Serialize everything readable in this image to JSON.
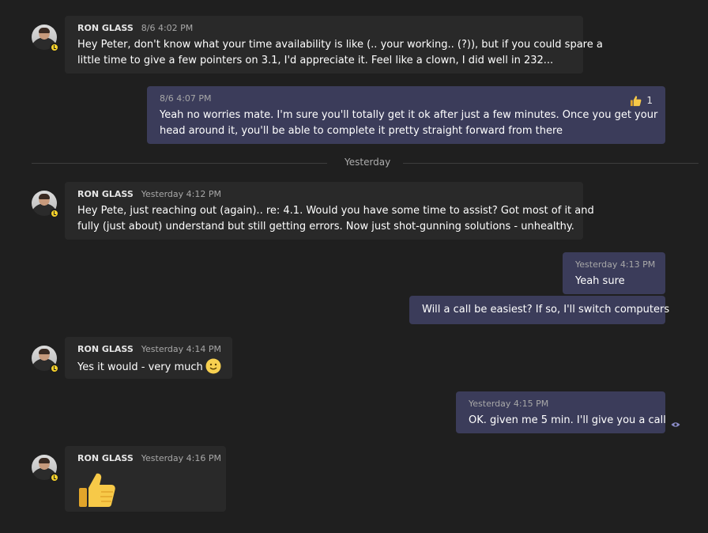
{
  "messages": [
    {
      "sender": "RON GLASS",
      "time": "8/6 4:02 PM",
      "line1": "Hey Peter, don't know what your time availability is like (.. your working.. (?)), but if you could spare a",
      "line2": "little time to give a few pointers on 3.1, I'd appreciate it. Feel like a clown, I did well in 232..."
    },
    {
      "time": "8/6 4:07 PM",
      "line1": "Yeah no worries mate. I'm sure you'll totally get it ok after just a few minutes. Once you get your",
      "line2": "head around it, you'll be able to complete it pretty straight forward from there",
      "reaction_count": "1",
      "reaction_icon": "thumbs-up-icon"
    },
    {
      "sender": "RON GLASS",
      "time": "Yesterday 4:12 PM",
      "line1": "Hey Pete, just reaching out (again).. re: 4.1. Would you have some time to assist? Got most of it and",
      "line2": "fully (just about) understand but still getting errors. Now just shot-gunning solutions - unhealthy."
    },
    {
      "time": "Yesterday 4:13 PM",
      "text": "Yeah sure"
    },
    {
      "text": "Will a call be easiest? If so, I'll switch computers"
    },
    {
      "sender": "RON GLASS",
      "time": "Yesterday 4:14 PM",
      "text": "Yes it would  - very much",
      "emoji": "smile-icon"
    },
    {
      "time": "Yesterday 4:15 PM",
      "text": "OK. given me 5 min. I'll give you a call"
    },
    {
      "sender": "RON GLASS",
      "time": "Yesterday 4:16 PM",
      "emoji": "thumbs-up-icon"
    }
  ],
  "divider": {
    "label": "Yesterday"
  },
  "colors": {
    "background": "#1f1f1f",
    "incoming": "#292929",
    "outgoing": "#3b3c5a",
    "status": "#f8d22a",
    "seen": "#8b8cc7"
  }
}
